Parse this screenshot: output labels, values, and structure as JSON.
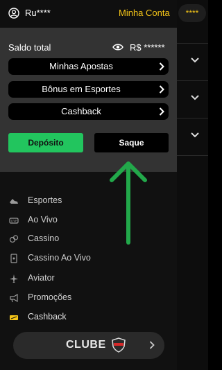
{
  "header": {
    "user_name": "Ru****",
    "account_link": "Minha Conta",
    "bg_balance_fragment": "****"
  },
  "wallet": {
    "balance_label": "Saldo total",
    "balance_value": "R$ ******",
    "menu": [
      {
        "label": "Minhas Apostas"
      },
      {
        "label": "Bônus em Esportes"
      },
      {
        "label": "Cashback"
      }
    ],
    "deposit_label": "Depósito",
    "withdraw_label": "Saque"
  },
  "nav": [
    {
      "label": "Esportes",
      "icon": "sports-icon"
    },
    {
      "label": "Ao Vivo",
      "icon": "live-icon"
    },
    {
      "label": "Cassino",
      "icon": "casino-icon"
    },
    {
      "label": "Cassino Ao Vivo",
      "icon": "live-casino-icon"
    },
    {
      "label": "Aviator",
      "icon": "airplane-icon"
    },
    {
      "label": "Promoções",
      "icon": "megaphone-icon"
    },
    {
      "label": "Cashback",
      "icon": "cashback-icon"
    }
  ],
  "clube": {
    "label": "CLUBE"
  },
  "colors": {
    "accent_yellow": "#f5c518",
    "deposit_green": "#22c55e",
    "arrow_green": "#22a84a"
  }
}
